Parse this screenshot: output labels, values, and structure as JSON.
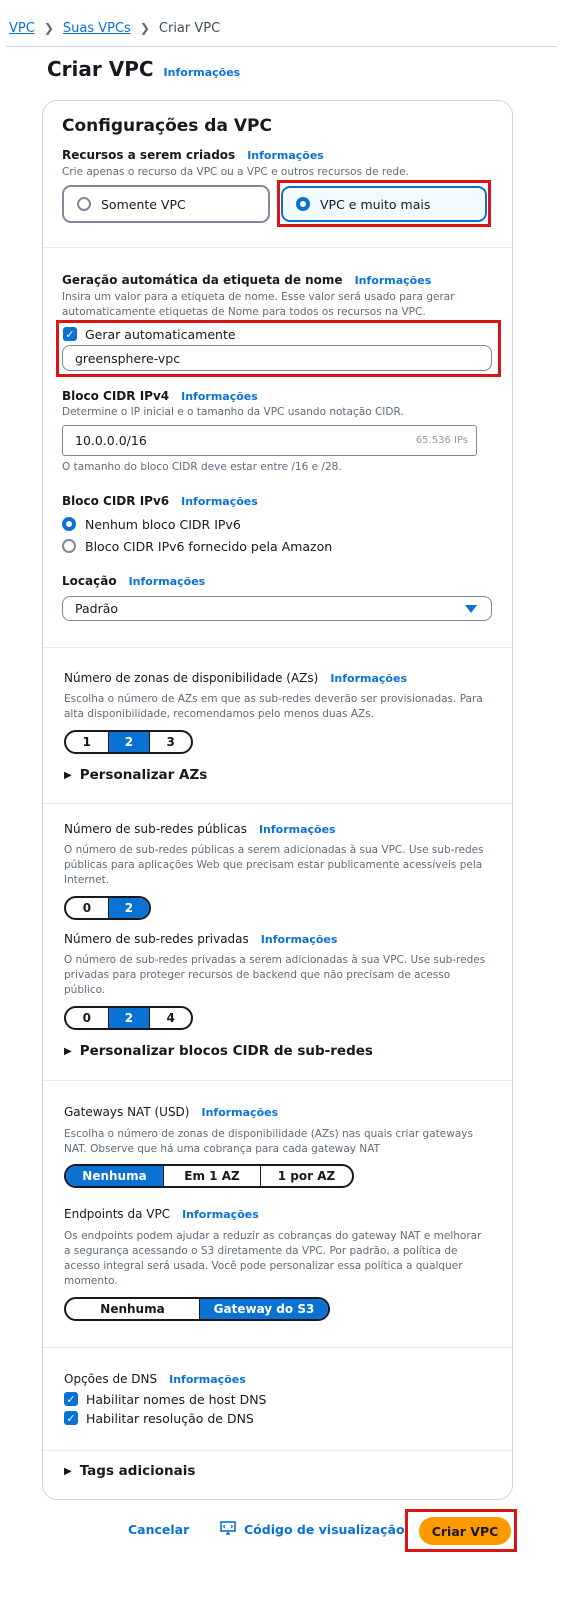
{
  "breadcrumb": {
    "items": [
      "VPC",
      "Suas VPCs"
    ],
    "current": "Criar VPC"
  },
  "page": {
    "title": "Criar VPC",
    "info": "Informações"
  },
  "card": {
    "title": "Configurações da VPC"
  },
  "resources": {
    "label": "Recursos a serem criados",
    "info": "Informações",
    "desc": "Crie apenas o recurso da VPC ou a VPC e outros recursos de rede.",
    "options": [
      "Somente VPC",
      "VPC e muito mais"
    ],
    "selected": "VPC e muito mais"
  },
  "nametag": {
    "label": "Geração automática da etiqueta de nome",
    "info": "Informações",
    "desc1": "Insira um valor para a etiqueta de nome. Esse valor será usado para gerar",
    "desc2": "automaticamente etiquetas de Nome para todos os recursos na VPC.",
    "checkbox_label": "Gerar automaticamente",
    "value": "greensphere-vpc"
  },
  "ipv4": {
    "label": "Bloco CIDR IPv4",
    "info": "Informações",
    "desc": "Determine o IP inicial e o tamanho da VPC usando notação CIDR.",
    "value": "10.0.0.0/16",
    "suffix": "65.536 IPs",
    "hint": "O tamanho do bloco CIDR deve estar entre /16 e /28."
  },
  "ipv6": {
    "label": "Bloco CIDR IPv6",
    "info": "Informações",
    "options": [
      "Nenhum bloco CIDR IPv6",
      "Bloco CIDR IPv6 fornecido pela Amazon"
    ],
    "selected": "Nenhum bloco CIDR IPv6"
  },
  "location": {
    "label": "Locação",
    "info": "Informações",
    "value": "Padrão"
  },
  "azs": {
    "label": "Número de zonas de disponibilidade (AZs)",
    "info": "Informações",
    "desc1": "Escolha o número de AZs em que as sub-redes deverão ser provisionadas. Para",
    "desc2": "alta disponibilidade, recomendamos pelo menos duas AZs.",
    "options": [
      "1",
      "2",
      "3"
    ],
    "selected": "2",
    "expander": "Personalizar AZs"
  },
  "public_subnets": {
    "label": "Número de sub-redes públicas",
    "info": "Informações",
    "desc1": "O número de sub-redes públicas a serem adicionadas à sua VPC. Use sub-redes",
    "desc2": "públicas para aplicações Web que precisam estar publicamente acessíveis pela",
    "desc3": "Internet.",
    "options": [
      "0",
      "2"
    ],
    "selected": "2"
  },
  "private_subnets": {
    "label": "Número de sub-redes privadas",
    "info": "Informações",
    "desc1": "O número de sub-redes privadas a serem adicionadas à sua VPC. Use sub-redes",
    "desc2": "privadas para proteger recursos de backend que não precisam de acesso",
    "desc3": "público.",
    "options": [
      "0",
      "2",
      "4"
    ],
    "selected": "2",
    "expander": "Personalizar blocos CIDR de sub-redes"
  },
  "nat": {
    "label": "Gateways NAT (USD)",
    "info": "Informações",
    "desc1": "Escolha o número de zonas de disponibilidade (AZs) nas quais criar gateways",
    "desc2": "NAT. Observe que há uma cobrança para cada gateway NAT",
    "options": [
      "Nenhuma",
      "Em 1 AZ",
      "1 por AZ"
    ],
    "selected": "Nenhuma"
  },
  "endpoints": {
    "label": "Endpoints da VPC",
    "info": "Informações",
    "desc1": "Os endpoints podem ajudar a reduzir as cobranças do gateway NAT e melhorar",
    "desc2": "a segurança acessando o S3 diretamente da VPC. Por padrão, a política de",
    "desc3": "acesso integral será usada. Você pode personalizar essa política a qualquer",
    "desc4": "momento.",
    "options": [
      "Nenhuma",
      "Gateway do S3"
    ],
    "selected": "Gateway do S3"
  },
  "dns": {
    "label": "Opções de DNS",
    "info": "Informações",
    "options": [
      "Habilitar nomes de host DNS",
      "Habilitar resolução de DNS"
    ]
  },
  "tags": {
    "expander": "Tags adicionais"
  },
  "footer": {
    "cancel": "Cancelar",
    "preview": "Código de visualização",
    "submit": "Criar VPC"
  },
  "colors": {
    "accent": "#0972d3",
    "primary": "#ff9900",
    "highlight": "#d91515"
  }
}
